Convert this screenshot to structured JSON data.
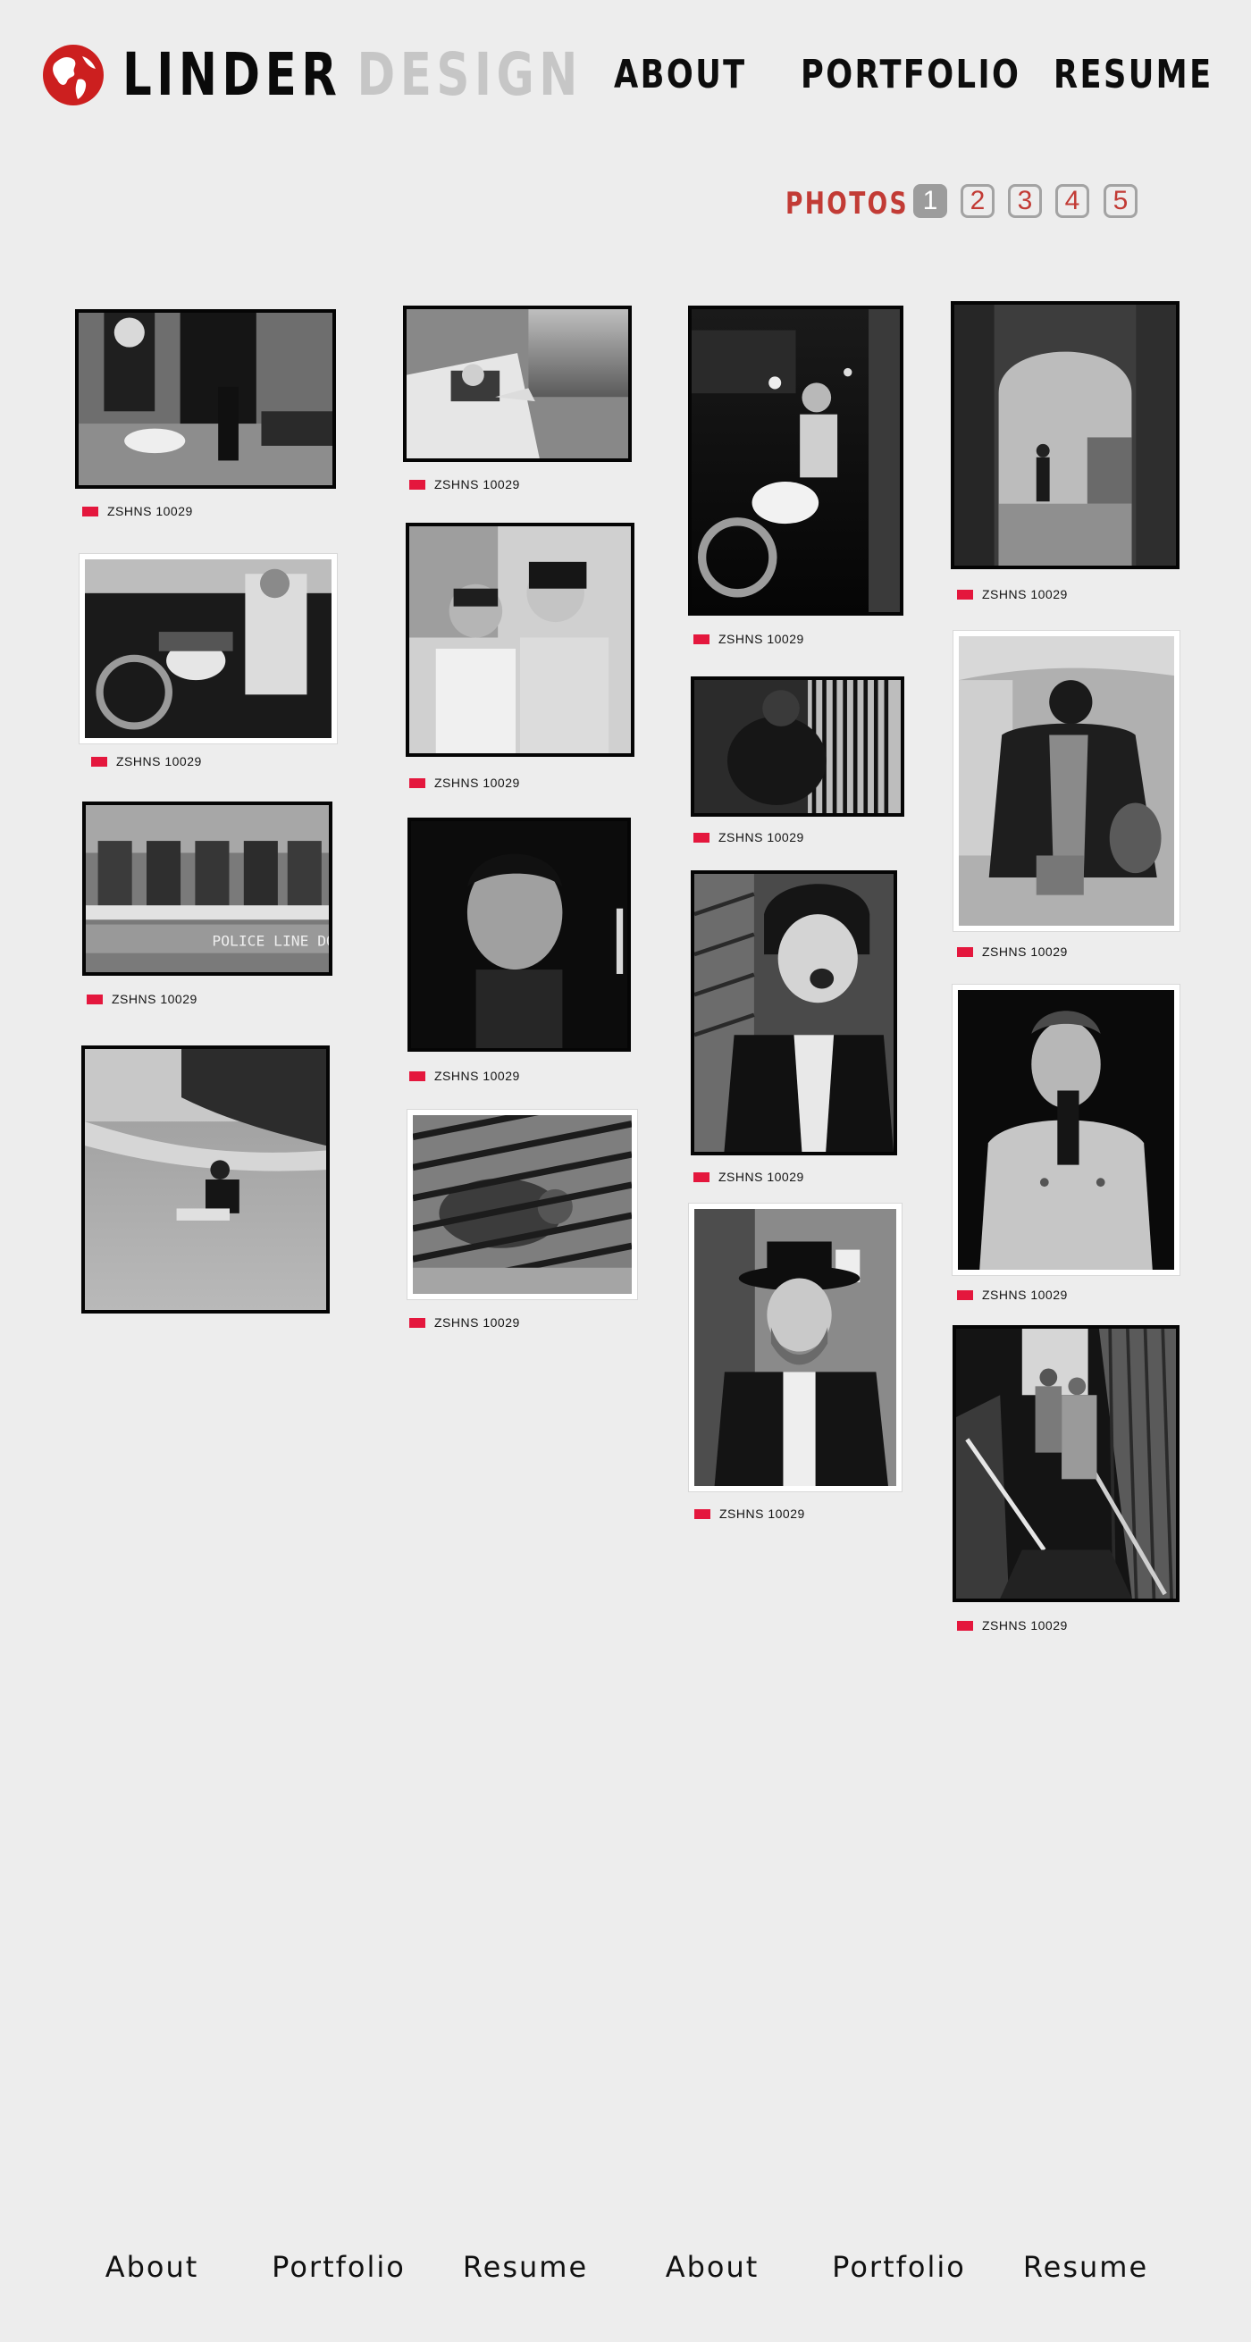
{
  "brand": {
    "name_part1": "LINDER",
    "name_part2": "DESIGN",
    "logo_icon": "globe-icon",
    "logo_color": "#cc1f1f"
  },
  "nav": {
    "items": [
      "ABOUT",
      "PORTFOLIO",
      "RESUME"
    ]
  },
  "gallery": {
    "section_label": "PHOTOS",
    "pages": [
      "1",
      "2",
      "3",
      "4",
      "5"
    ],
    "active_page": "1",
    "caption_flag_color": "#e4173d",
    "photos": [
      {
        "caption": "ZSHNS 10029",
        "subject": "police officers kneeling on street"
      },
      {
        "caption": "ZSHNS 10029",
        "subject": "man with motorcycle"
      },
      {
        "caption": "ZSHNS 10029",
        "subject": "women seated on bench, police line"
      },
      {
        "caption": "",
        "subject": "man sitting on beach"
      },
      {
        "caption": "ZSHNS 10029",
        "subject": "man leaning out of taxi"
      },
      {
        "caption": "ZSHNS 10029",
        "subject": "two women portrait"
      },
      {
        "caption": "ZSHNS 10029",
        "subject": "young man looking up"
      },
      {
        "caption": "ZSHNS 10029",
        "subject": "hyena behind bars"
      },
      {
        "caption": "ZSHNS 10029",
        "subject": "man on motorcycle at night"
      },
      {
        "caption": "ZSHNS 10029",
        "subject": "man leaning on railing"
      },
      {
        "caption": "ZSHNS 10029",
        "subject": "woman laughing"
      },
      {
        "caption": "ZSHNS 10029",
        "subject": "smiling man in hat"
      },
      {
        "caption": "ZSHNS 10029",
        "subject": "man under archway"
      },
      {
        "caption": "ZSHNS 10029",
        "subject": "woman in fur coat"
      },
      {
        "caption": "ZSHNS 10029",
        "subject": "shirtless man with pistol"
      },
      {
        "caption": "ZSHNS 10029",
        "subject": "couple climbing stairs"
      }
    ]
  },
  "footer": {
    "links": [
      "About",
      "Portfolio",
      "Resume",
      "About",
      "Portfolio",
      "Resume"
    ]
  }
}
